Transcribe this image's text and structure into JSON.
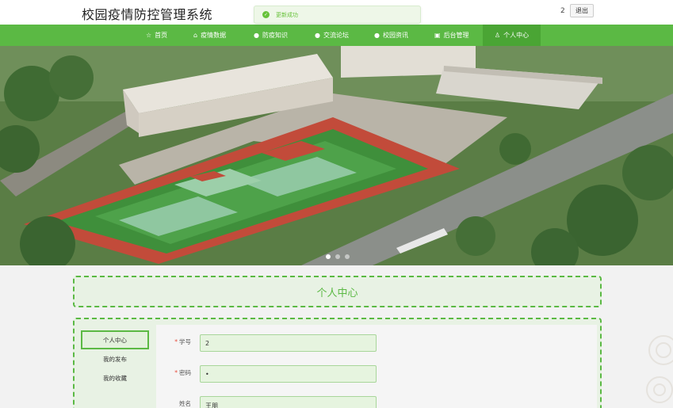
{
  "header": {
    "title": "校园疫情防控管理系统",
    "user_num": "2",
    "logout_label": "退出"
  },
  "toast": {
    "message": "更新成功",
    "icon": "check-circle-icon",
    "color": "#67c23a"
  },
  "nav": {
    "items": [
      {
        "label": "首页",
        "icon": "star-icon"
      },
      {
        "label": "疫情数据",
        "icon": "bag-icon"
      },
      {
        "label": "防疫知识",
        "icon": "info-icon"
      },
      {
        "label": "交流论坛",
        "icon": "info-icon"
      },
      {
        "label": "校园资讯",
        "icon": "info-icon"
      },
      {
        "label": "后台管理",
        "icon": "admin-icon"
      },
      {
        "label": "个人中心",
        "icon": "user-icon",
        "active": true
      }
    ],
    "color": "#5bb944",
    "active_color": "#4aa534"
  },
  "banner": {
    "slides": 3,
    "current": 1
  },
  "page": {
    "title": "个人中心"
  },
  "side_menu": {
    "items": [
      {
        "label": "个人中心",
        "active": true
      },
      {
        "label": "我的发布"
      },
      {
        "label": "我的收藏"
      }
    ]
  },
  "form": {
    "fields": [
      {
        "label": "学号",
        "required": true,
        "value": "2"
      },
      {
        "label": "密码",
        "required": true,
        "value": "•"
      },
      {
        "label": "姓名",
        "required": false,
        "value": "王朋"
      }
    ]
  }
}
